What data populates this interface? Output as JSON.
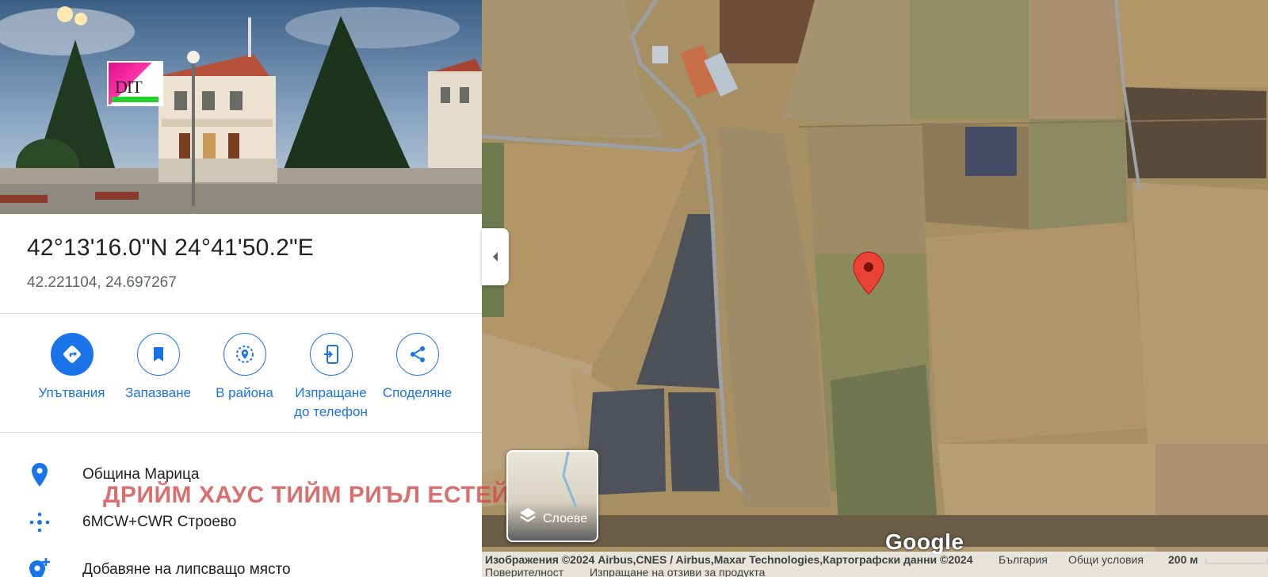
{
  "place": {
    "coords_dms": "42°13'16.0\"N 24°41'50.2\"E",
    "coords_decimal": "42.221104, 24.697267"
  },
  "actions": [
    {
      "label": "Упътвания",
      "icon": "directions-icon"
    },
    {
      "label": "Запазване",
      "icon": "bookmark-icon"
    },
    {
      "label": "В района",
      "icon": "nearby-icon"
    },
    {
      "label": "Изпращане до телефон",
      "icon": "send-to-phone-icon"
    },
    {
      "label": "Споделяне",
      "icon": "share-icon"
    }
  ],
  "details": {
    "municipality": "Община Марица",
    "plus_code": "6MCW+CWR Строево",
    "add_place": "Добавяне на липсващо място"
  },
  "watermark": "ДРИЙМ ХАУС ТИЙМ РИЪЛ ЕСТЕЙТ",
  "map": {
    "layers_label": "Слоеве",
    "google_logo": "Google",
    "attribution": "Изображения ©2024 Airbus,CNES / Airbus,Maxar Technologies,Картографски данни ©2024",
    "country": "България",
    "terms": "Общи условия",
    "scale": "200 м",
    "privacy": "Поверителност",
    "feedback": "Изпращане на отзиви за продукта"
  },
  "colors": {
    "accent": "#1a73e8",
    "pin": "#ea4335",
    "watermark": "#cd4848"
  }
}
